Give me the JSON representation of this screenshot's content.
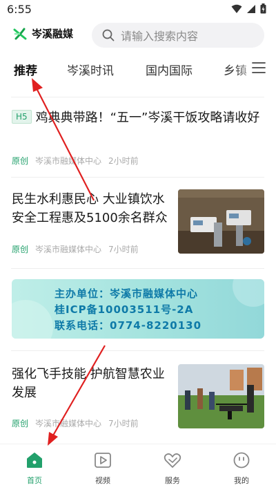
{
  "status_bar": {
    "time": "6:55"
  },
  "header": {
    "logo_text": "岑溪融媒",
    "search_placeholder": "请输入搜索内容"
  },
  "tabs": [
    {
      "label": "推荐",
      "active": true
    },
    {
      "label": "岑溪时讯",
      "active": false
    },
    {
      "label": "国内国际",
      "active": false
    },
    {
      "label": "乡镇",
      "active": false
    }
  ],
  "articles": [
    {
      "badge": "H5",
      "title": "鸡典典带路！“五一”岑溪干饭攻略请收好",
      "tag": "原创",
      "source": "岑溪市融媒体中心",
      "time": "2小时前"
    },
    {
      "title": "民生水利惠民心 大业镇饮水安全工程惠及5100余名群众",
      "tag": "原创",
      "source": "岑溪市融媒体中心",
      "time": "7小时前"
    },
    {
      "title": "强化飞手技能 护航智慧农业发展",
      "tag": "原创",
      "source": "岑溪市融媒体中心",
      "time": "7小时前"
    }
  ],
  "banner": {
    "line1": "主办单位：岑溪市融媒体中心",
    "line2": "桂ICP备10003511号-2A",
    "line3": "联系电话：0774-8220130"
  },
  "bottom_nav": [
    {
      "label": "首页",
      "icon": "home-icon",
      "active": true
    },
    {
      "label": "视频",
      "icon": "video-icon",
      "active": false
    },
    {
      "label": "服务",
      "icon": "service-icon",
      "active": false
    },
    {
      "label": "我的",
      "icon": "profile-icon",
      "active": false
    }
  ],
  "colors": {
    "accent": "#22a06b",
    "annotation_arrow": "#e02020"
  }
}
